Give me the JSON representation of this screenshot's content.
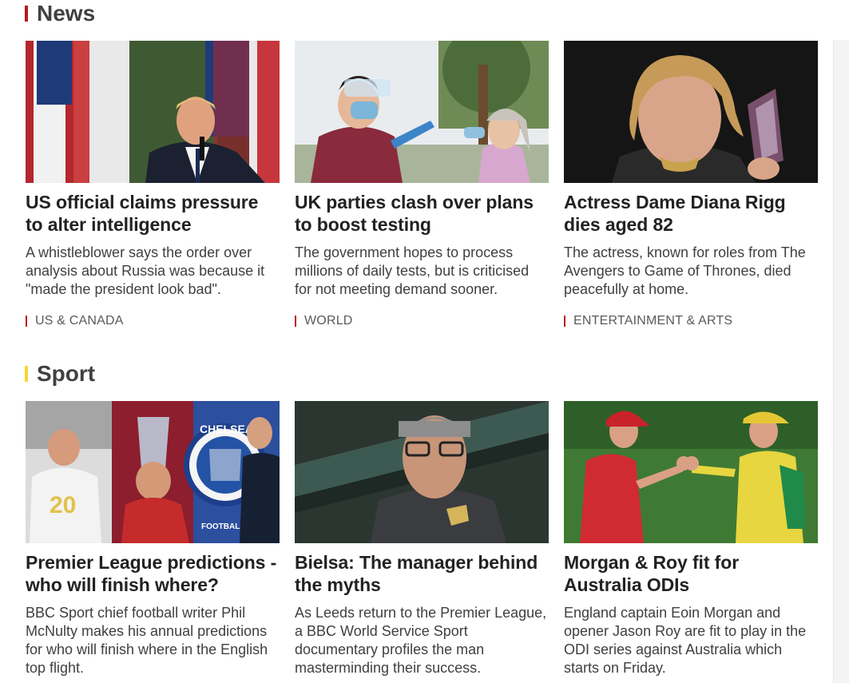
{
  "colors": {
    "news_accent": "#bb1919",
    "sport_accent": "#ffd230",
    "tag_tick": "#bb1919"
  },
  "sections": [
    {
      "title": "News",
      "cards": [
        {
          "image": "donald-trump-photo",
          "headline": "US official claims pressure to alter intelligence",
          "summary": "A whistleblower says the order over analysis about Russia was because it \"made the president look bad\".",
          "tag": "US & CANADA"
        },
        {
          "image": "covid-test-photo",
          "headline": "UK parties clash over plans to boost testing",
          "summary": "The government hopes to process millions of daily tests, but is criticised for not meeting demand sooner.",
          "tag": "WORLD"
        },
        {
          "image": "diana-rigg-photo",
          "headline": "Actress Dame Diana Rigg dies aged 82",
          "summary": "The actress, known for roles from The Avengers to Game of Thrones, died peacefully at home.",
          "tag": "ENTERTAINMENT & ARTS"
        }
      ]
    },
    {
      "title": "Sport",
      "cards": [
        {
          "image": "premier-league-collage-photo",
          "headline": "Premier League predictions - who will finish where?",
          "summary": "BBC Sport chief football writer Phil McNulty makes his annual predictions for who will finish where in the English top flight."
        },
        {
          "image": "marcelo-bielsa-photo",
          "headline": "Bielsa: The manager behind the myths",
          "summary": "As Leeds return to the Premier League, a BBC World Service Sport documentary profiles the man masterminding their success."
        },
        {
          "image": "cricket-fist-bump-photo",
          "headline": "Morgan & Roy fit for Australia ODIs",
          "summary": "England captain Eoin Morgan and opener Jason Roy are fit to play in the ODI series against Australia which starts on Friday."
        }
      ]
    }
  ],
  "photo_text": {
    "shirt_number": "20",
    "badge_text": "CHELSEA",
    "badge_sub": "FOOTBALL"
  }
}
